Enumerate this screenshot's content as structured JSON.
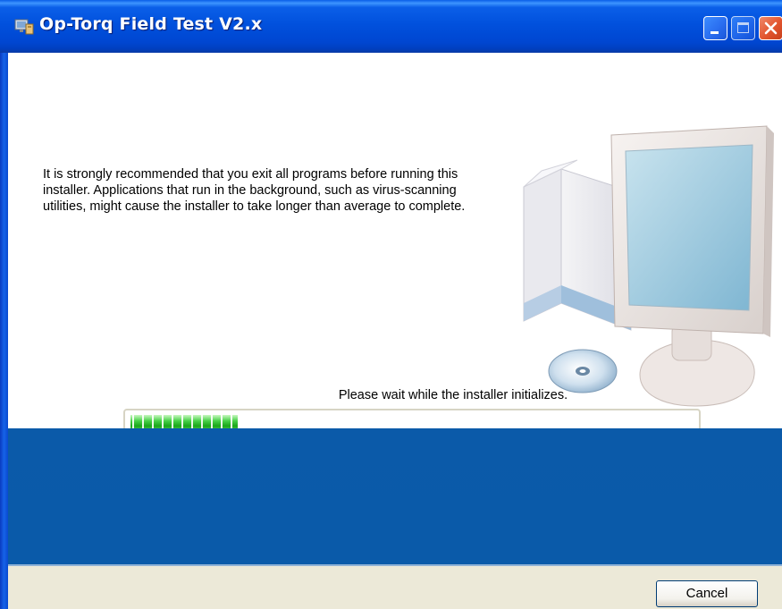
{
  "window": {
    "title": "Op-Torq Field Test V2.x",
    "controls": {
      "minimize": "minimize",
      "maximize": "maximize",
      "close": "close"
    }
  },
  "message": "It is strongly recommended that you exit all programs before running this\ninstaller. Applications that run in the background, such as virus-scanning\nutilities, might cause the installer to take longer than average to complete.",
  "status": "Please wait while the installer initializes.",
  "progress": {
    "percent": 19
  },
  "footer": {
    "cancel_label": "Cancel"
  },
  "colors": {
    "titlebar": "#0151dd",
    "band": "#0a5aa9",
    "progress": "#1aa61a",
    "footer": "#ece9d8"
  },
  "icons": {
    "app": "installer-app-icon",
    "illustration": "computer-and-disc-illustration"
  }
}
